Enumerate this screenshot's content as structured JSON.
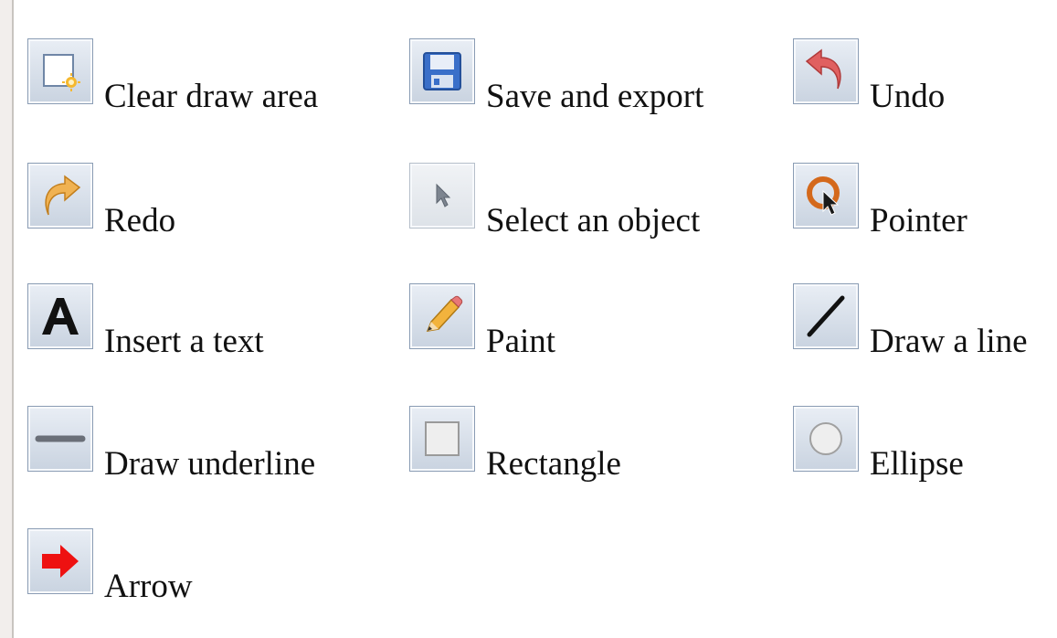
{
  "tools": [
    {
      "id": "clear",
      "label": "Clear draw area",
      "icon": "clear-canvas-icon"
    },
    {
      "id": "save",
      "label": "Save and export",
      "icon": "floppy-disk-icon"
    },
    {
      "id": "undo",
      "label": "Undo",
      "icon": "undo-arrow-icon"
    },
    {
      "id": "redo",
      "label": "Redo",
      "icon": "redo-arrow-icon"
    },
    {
      "id": "select",
      "label": "Select an object",
      "icon": "cursor-arrow-icon"
    },
    {
      "id": "pointer",
      "label": "Pointer",
      "icon": "laser-pointer-icon"
    },
    {
      "id": "text",
      "label": "Insert a text",
      "icon": "letter-a-icon"
    },
    {
      "id": "paint",
      "label": "Paint",
      "icon": "pencil-icon"
    },
    {
      "id": "line",
      "label": "Draw a line",
      "icon": "diagonal-line-icon"
    },
    {
      "id": "underline",
      "label": "Draw underline",
      "icon": "horizontal-line-icon"
    },
    {
      "id": "rectangle",
      "label": "Rectangle",
      "icon": "rectangle-icon"
    },
    {
      "id": "ellipse",
      "label": "Ellipse",
      "icon": "ellipse-icon"
    },
    {
      "id": "arrow",
      "label": "Arrow",
      "icon": "red-arrow-icon"
    }
  ],
  "colors": {
    "button_border": "#8a9cb4",
    "undo_red": "#d94a4a",
    "redo_orange": "#e8a23a",
    "pointer_orange": "#d4691c",
    "arrow_red": "#ee1111"
  }
}
